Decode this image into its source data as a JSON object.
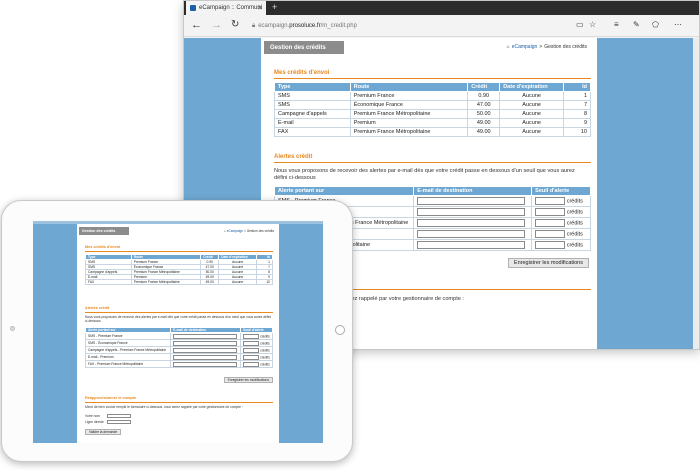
{
  "browser": {
    "tab_title": "eCampaign :: Communi",
    "tab_close": "✕",
    "new_tab": "+",
    "url_prefix": "ecampaign.",
    "url_host": "prosoluce.fr",
    "url_path": "/m_credit.php"
  },
  "page": {
    "header": "Gestion des crédits",
    "breadcrumb_link": "eCampaign",
    "breadcrumb_sep": ">",
    "breadcrumb_current": "Gestion des crédits",
    "credits": {
      "title": "Mes crédits d'envoi",
      "columns": [
        "Type",
        "Route",
        "Crédit",
        "Date d'expiration",
        "Id"
      ],
      "rows": [
        [
          "SMS",
          "Premium France",
          "0.90",
          "Aucune",
          "1"
        ],
        [
          "SMS",
          "Économique France",
          "47.00",
          "Aucune",
          "7"
        ],
        [
          "Campagne d'appels",
          "Premium France Métropolitaine",
          "50.00",
          "Aucune",
          "8"
        ],
        [
          "E-mail",
          "Premium",
          "49.00",
          "Aucune",
          "9"
        ],
        [
          "FAX",
          "Premium France Métropolitaine",
          "49.00",
          "Aucune",
          "10"
        ]
      ]
    },
    "alerts": {
      "title": "Alertes crédit",
      "intro": "Nous vous proposons de recevoir des alertes par e-mail dès que votre crédit passe en dessous d'un seuil que vous aurez défini ci-dessous",
      "columns": [
        "Alerte portant sur",
        "E-mail de destination",
        "Seuil d'alerte"
      ],
      "rows": [
        "SMS - Premium France",
        "SMS - Économique France",
        "Campagne d'appels - Premium France Métropolitaine",
        "E-mail - Premium",
        "FAX - Premium France Métropolitaine"
      ],
      "unit": "crédits",
      "save_label": "Enregistrer les modifications"
    },
    "callback": {
      "title": "Réapprovisionner le compte",
      "intro": "Merci de bien vouloir remplir le formulaire ci-dessous, vous serez rappelé par votre gestionnaire de compte :",
      "intro_visible": "formulaire ci-dessous, vous serez rappelé par votre gestionnaire de compte :",
      "name_label": "Votre nom",
      "phone_label": "Ligne directe",
      "submit_label": "Valider la demande"
    }
  }
}
